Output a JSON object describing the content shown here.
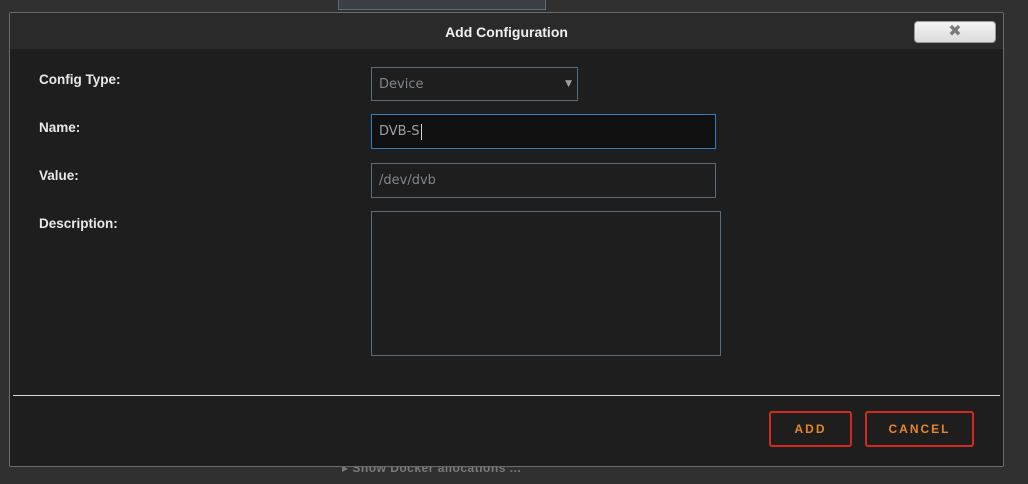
{
  "background": {
    "partial_text": "▸ Show Docker allocations ..."
  },
  "dialog": {
    "title": "Add Configuration",
    "close_icon": "close-icon",
    "close_glyph": "✖"
  },
  "form": {
    "config_type": {
      "label": "Config Type:",
      "selected": "Device",
      "arrow": "▼"
    },
    "name": {
      "label": "Name:",
      "value": "DVB-S"
    },
    "value": {
      "label": "Value:",
      "value": "/dev/dvb"
    },
    "description": {
      "label": "Description:",
      "value": ""
    }
  },
  "footer": {
    "add_label": "ADD",
    "cancel_label": "CANCEL"
  },
  "colors": {
    "dialog_bg": "#1e1e1e",
    "accent_border": "#d22a1e",
    "accent_text": "#e8852a",
    "focus_border": "#2f7fbf"
  }
}
